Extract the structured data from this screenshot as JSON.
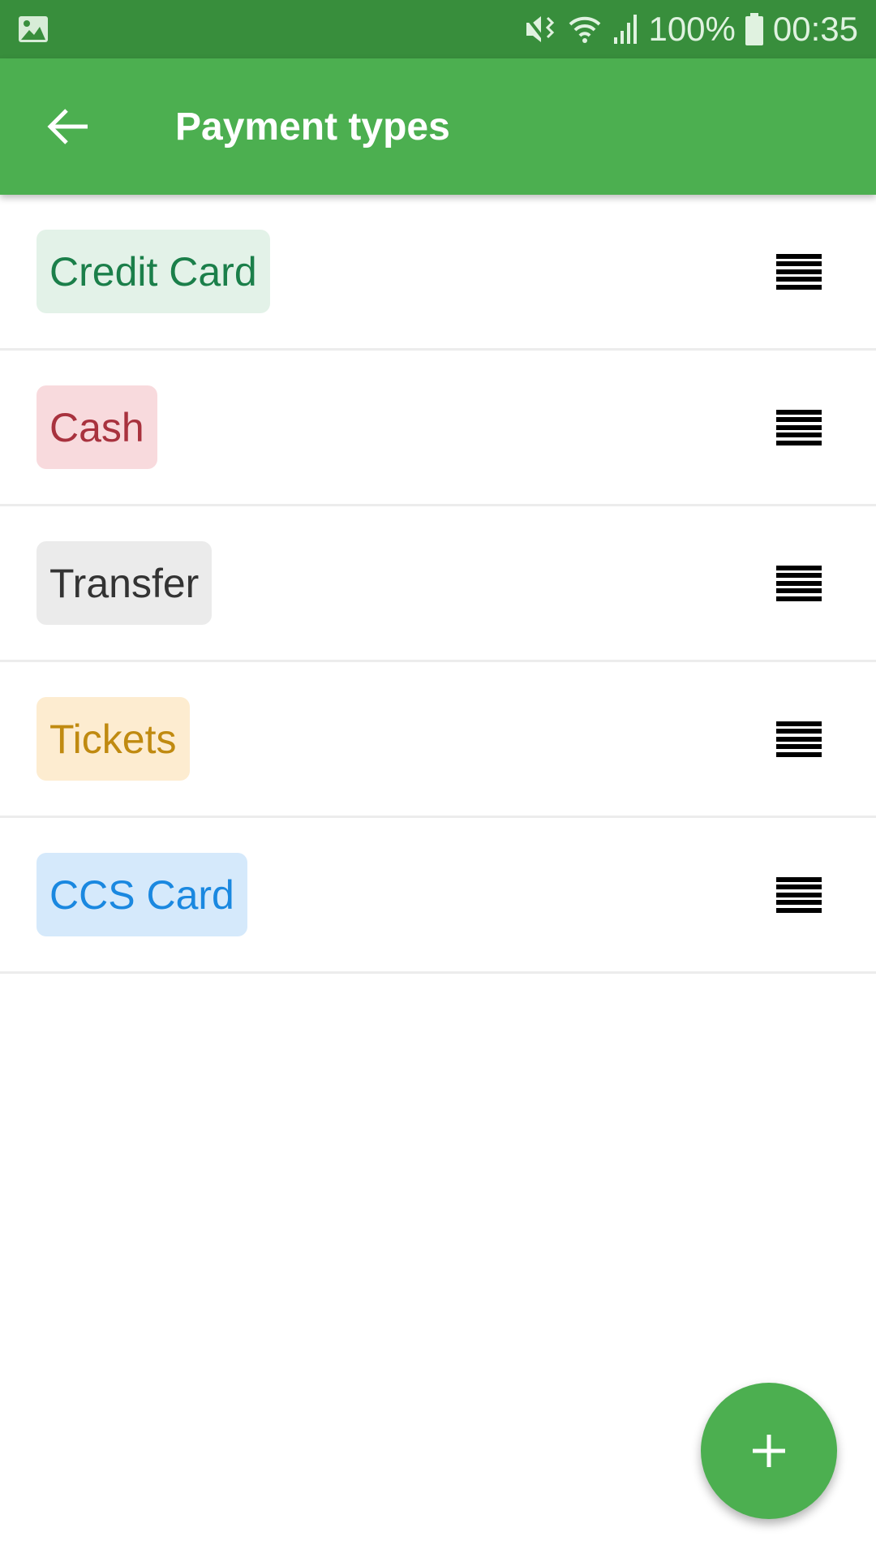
{
  "status_bar": {
    "battery": "100%",
    "time": "00:35",
    "icons": [
      "image-icon",
      "vibrate-icon",
      "wifi-icon",
      "signal-icon",
      "battery-icon"
    ]
  },
  "app_bar": {
    "title": "Payment types",
    "back_icon": "arrow-left-icon",
    "color": "#4caf50"
  },
  "payment_types": [
    {
      "label": "Credit Card",
      "text_color": "#1b7f4a",
      "bg_color": "#e3f2e8"
    },
    {
      "label": "Cash",
      "text_color": "#a8323e",
      "bg_color": "#f8dadd"
    },
    {
      "label": "Transfer",
      "text_color": "#333333",
      "bg_color": "#ebebeb"
    },
    {
      "label": "Tickets",
      "text_color": "#c08a10",
      "bg_color": "#fdecd0"
    },
    {
      "label": "CCS Card",
      "text_color": "#1a88e0",
      "bg_color": "#d5e9fb"
    }
  ],
  "fab": {
    "icon": "plus-icon"
  }
}
